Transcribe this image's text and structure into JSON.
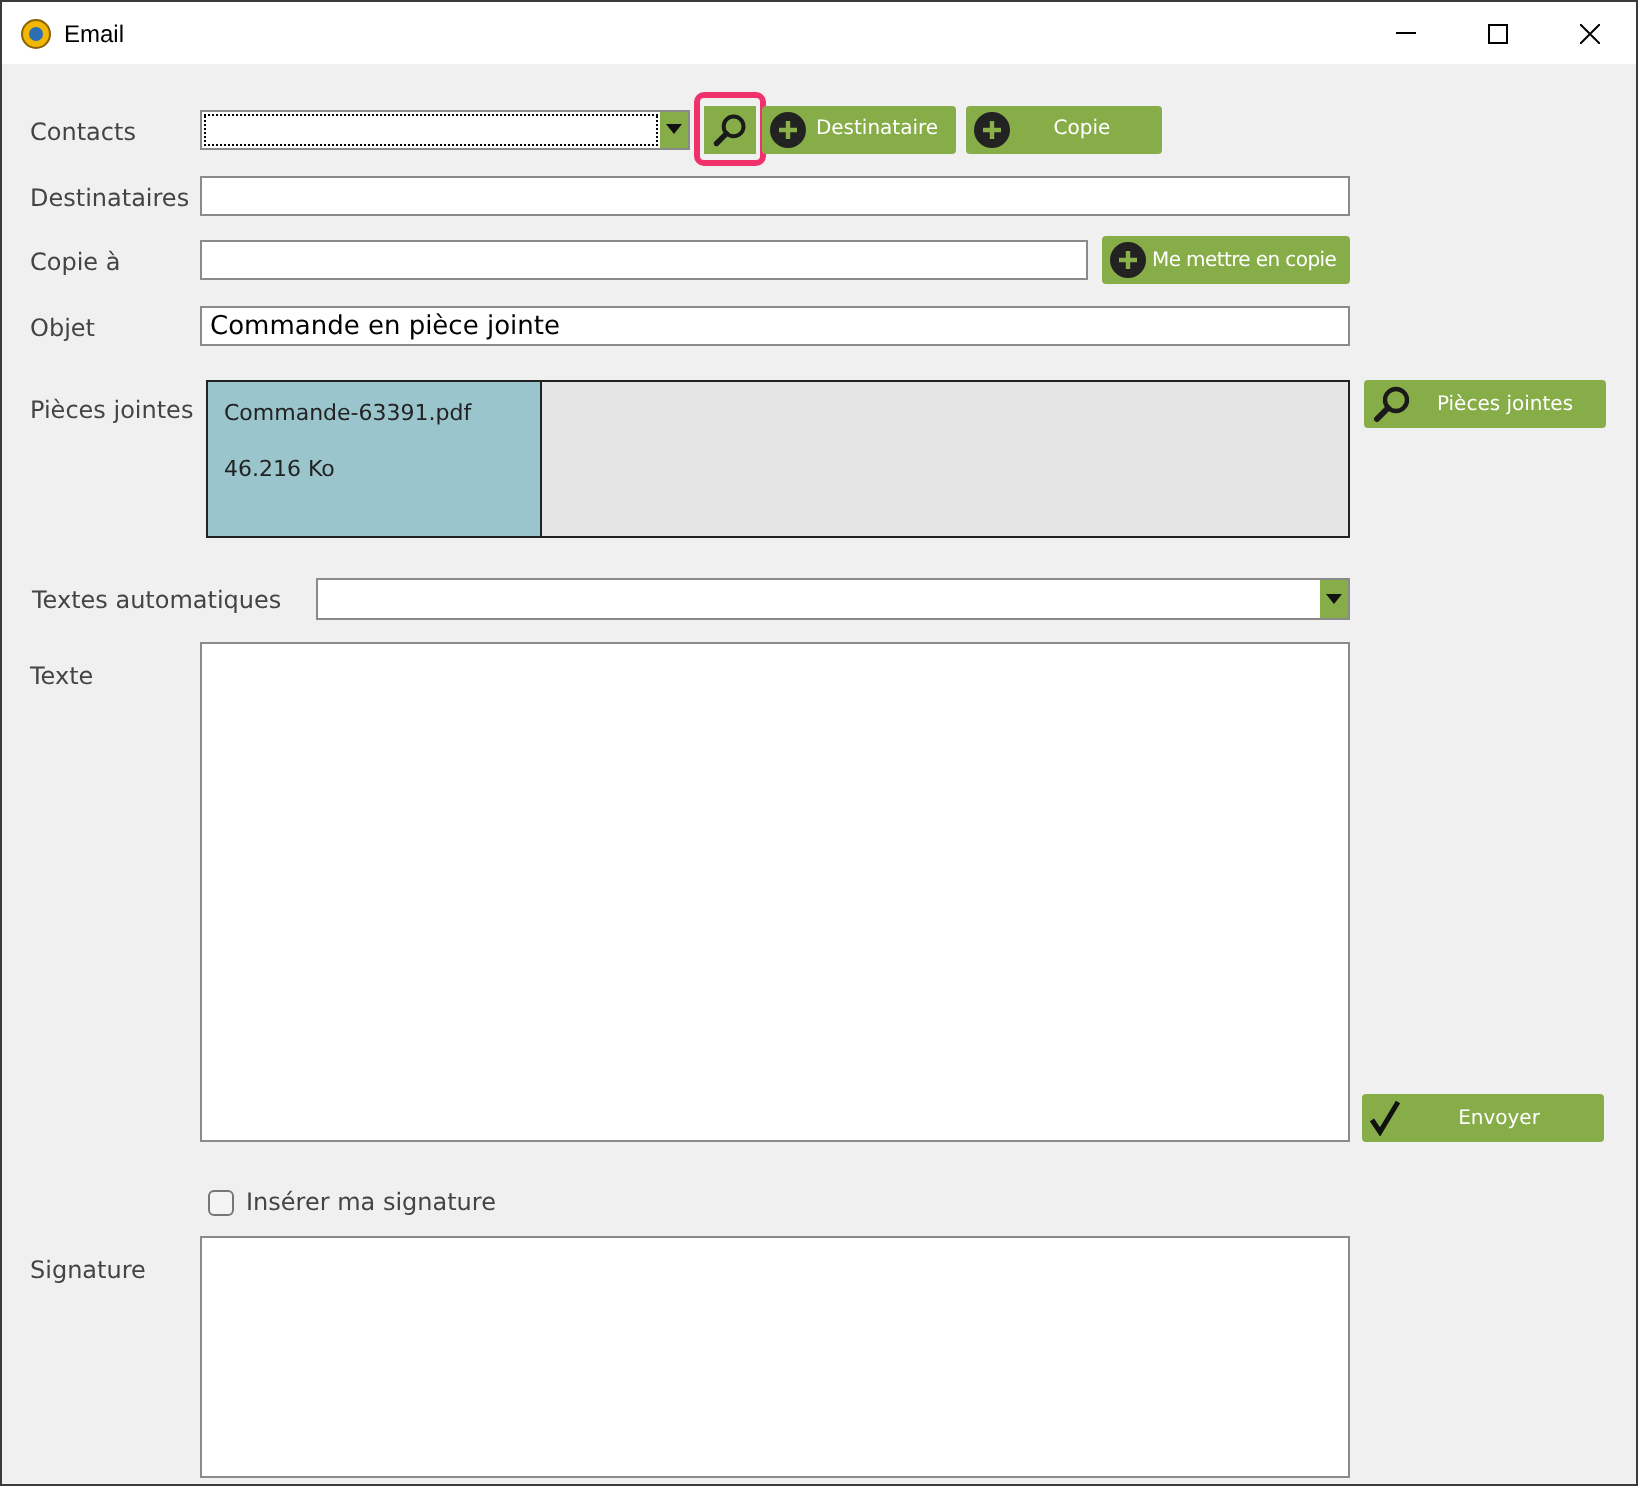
{
  "window": {
    "title": "Email"
  },
  "contacts": {
    "label": "Contacts",
    "search_highlighted": true,
    "buttons": [
      "Destinataire",
      "Copie"
    ]
  },
  "recipients": {
    "label": "Destinataires"
  },
  "cc": {
    "label": "Copie à",
    "button": "Me mettre en copie"
  },
  "subject": {
    "label": "Objet",
    "value": "Commande en pièce jointe"
  },
  "attachments": {
    "label": "Pièces jointes",
    "button": "Pièces jointes",
    "items": [
      {
        "name": "Commande-63391.pdf",
        "size": "46.216 Ko"
      }
    ]
  },
  "auto_texts": {
    "label": "Textes automatiques"
  },
  "body": {
    "label": "Texte",
    "send_button": "Envoyer"
  },
  "insert_signature": {
    "label": "Insérer ma signature",
    "checked": false
  },
  "signature": {
    "label": "Signature"
  }
}
